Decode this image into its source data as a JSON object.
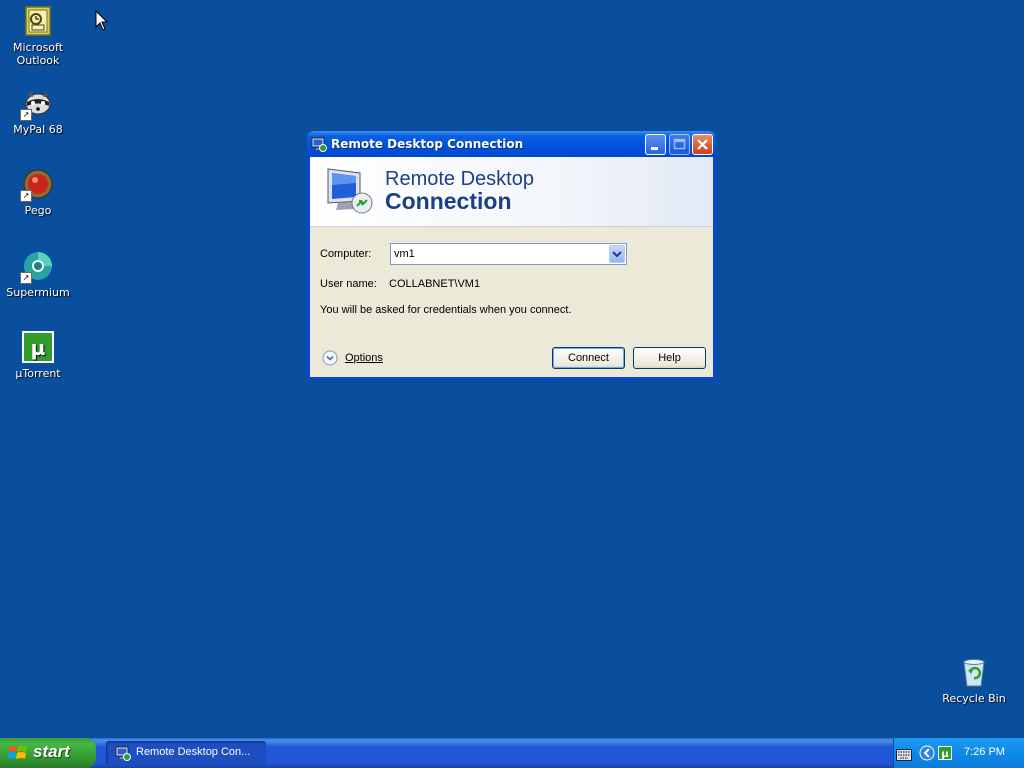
{
  "desktop": {
    "icons": [
      {
        "label": "Microsoft Outlook"
      },
      {
        "label": "MyPal 68"
      },
      {
        "label": "Pego"
      },
      {
        "label": "Supermium"
      },
      {
        "label": "µTorrent"
      },
      {
        "label": "Recycle Bin"
      }
    ]
  },
  "dialog": {
    "title": "Remote Desktop Connection",
    "banner_line1": "Remote Desktop",
    "banner_line2": "Connection",
    "computer_label": "Computer:",
    "computer_value": "vm1",
    "username_label": "User name:",
    "username_value": "COLLABNET\\VM1",
    "info_text": "You will be asked for credentials when you connect.",
    "options_label": "Options",
    "connect_label": "Connect",
    "help_label": "Help"
  },
  "taskbar": {
    "start_label": "start",
    "task_label": "Remote Desktop Con...",
    "clock": "7:26 PM"
  },
  "colors": {
    "desktop": "#0a4f9e",
    "titlebar": "#0052e0",
    "dialog_bg": "#ece9d8",
    "banner_text": "#1b3f8a"
  }
}
